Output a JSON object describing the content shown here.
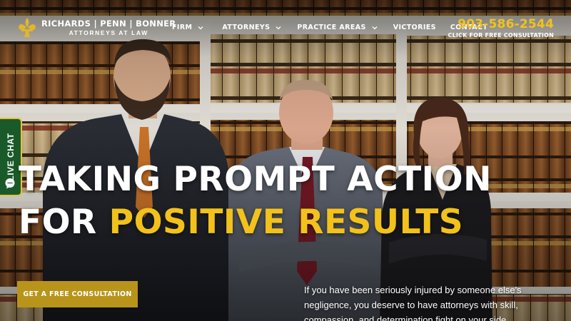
{
  "brand": {
    "firm_name": "RICHARDS | PENN | BONNER",
    "tagline": "ATTORNEYS AT LAW",
    "logo_icon": "fleur-de-lis-icon",
    "gold_color": "#f2c21b"
  },
  "nav": {
    "items": [
      {
        "label": "FIRM",
        "dropdown": true
      },
      {
        "label": "ATTORNEYS",
        "dropdown": true
      },
      {
        "label": "PRACTICE AREAS",
        "dropdown": true
      },
      {
        "label": "VICTORIES",
        "dropdown": false
      },
      {
        "label": "CONTACT",
        "dropdown": false
      }
    ]
  },
  "contact": {
    "phone": "903-586-2544",
    "phone_sub": "CLICK FOR FREE CONSULTATION"
  },
  "live_chat": {
    "label": "LIVE CHAT",
    "color": "#1a5a2a"
  },
  "hero": {
    "headline_line1": "TAKING PROMPT ACTION",
    "headline_line2_white": "FOR ",
    "headline_line2_gold": "POSITIVE RESULTS",
    "cta_label": "GET A FREE CONSULTATION",
    "cta_color": "#b8941a",
    "intro": "If you have been seriously injured by someone else's negligence, you deserve to have attorneys with skill, compassion, and determination fight on your side."
  }
}
